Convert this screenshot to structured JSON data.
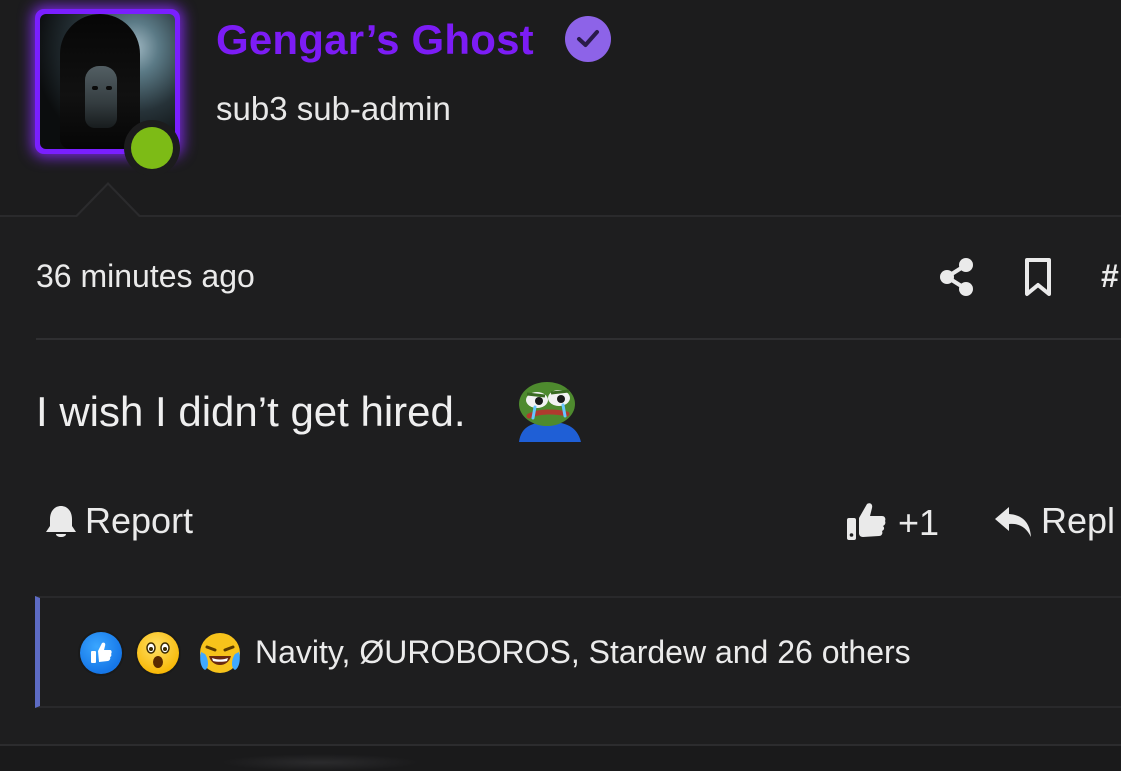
{
  "user": {
    "name": "Gengar’s Ghost",
    "title": "sub3 sub-admin",
    "verified": true,
    "online": true,
    "accent_color": "#7c1cf5",
    "online_color": "#7dbb16"
  },
  "post": {
    "timestamp": "36 minutes ago",
    "permalink_label": "#",
    "body": "I wish I didn’t get hired.",
    "emoji": "sad-pepe-emoji"
  },
  "actions": {
    "report_label": "Report",
    "like_count": "+1",
    "reply_label": "Repl"
  },
  "reactions": {
    "icons": [
      "like-reaction",
      "wow-reaction",
      "laugh-cry-reaction"
    ],
    "text": "Navity, ØUROBOROS, Stardew and 26 others",
    "border_color": "#5d6bc3"
  }
}
